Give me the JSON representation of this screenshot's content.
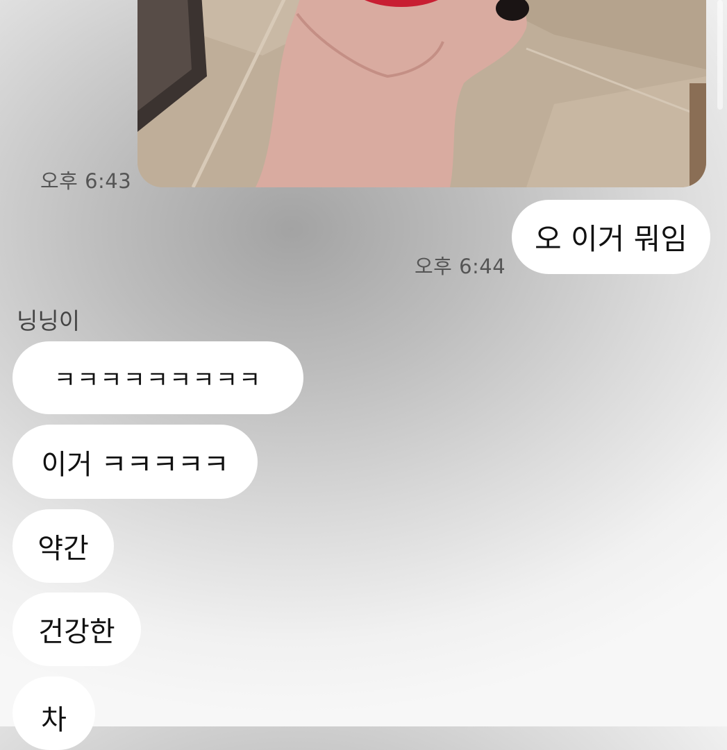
{
  "photo_message": {
    "time": "오후 6:43"
  },
  "sent_message": {
    "text": "오 이거 뭐임",
    "time": "오후 6:44"
  },
  "received": {
    "sender": "닝닝이",
    "messages": [
      "ㅋㅋㅋㅋㅋㅋㅋㅋㅋ",
      "이거 ㅋㅋㅋㅋㅋ",
      "약간",
      "건강한",
      "차"
    ]
  }
}
